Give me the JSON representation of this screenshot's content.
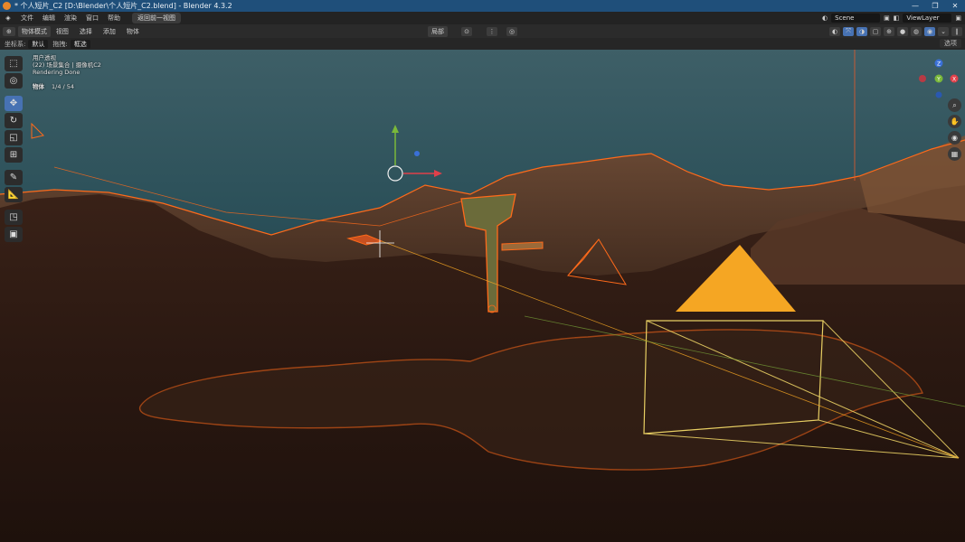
{
  "window": {
    "title": "* 个人短片_C2 [D:\\Blender\\个人短片_C2.blend] - Blender 4.3.2",
    "min": "—",
    "max": "❐",
    "close": "✕"
  },
  "menu": {
    "items": [
      "文件",
      "编辑",
      "渲染",
      "窗口",
      "帮助"
    ],
    "workspace": "返回前一视图",
    "scene": "Scene",
    "view_layer": "ViewLayer"
  },
  "header": {
    "editor_icon": "⊕",
    "mode": "物体模式",
    "items": [
      "视图",
      "选择",
      "添加",
      "物体"
    ],
    "transform_pivot": "局部",
    "options": "选项"
  },
  "toolsettings": {
    "orientation_label": "坐标系:",
    "orientation_value": "默认",
    "drag_label": "拖拽:",
    "drag_value": "框选"
  },
  "viewport": {
    "view_name": "用户透视",
    "collection_line": "(22) 场景集合 | 摄像机C2",
    "status": "Rendering Done",
    "objects_label": "物体",
    "objects_count": "1/4 / 54"
  },
  "gizmo": {
    "z": "Z",
    "y": "Y",
    "x": "X"
  },
  "colors": {
    "accent": "#4772b3",
    "selection": "#ff7a1a",
    "camera_active": "#f5a623",
    "camera_frame": "#e8cf63"
  }
}
